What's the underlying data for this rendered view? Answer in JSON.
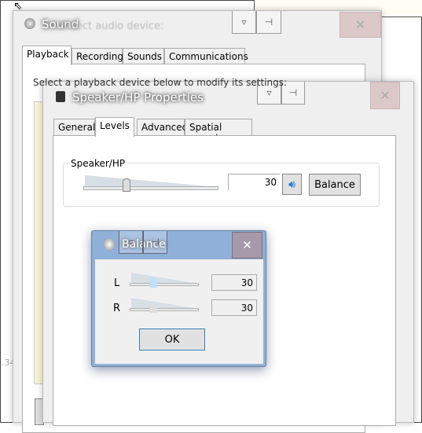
{
  "sound_window": {
    "title": "Sound",
    "subtitle_behind": "Select audio device:",
    "tabs": [
      {
        "label": "Playback",
        "selected": true
      },
      {
        "label": "Recording",
        "selected": false
      },
      {
        "label": "Sounds",
        "selected": false
      },
      {
        "label": "Communications",
        "selected": false
      }
    ],
    "instruction": "Select a playback device below to modify its settings:",
    "close_icon": "close-icon",
    "background_number": ".34"
  },
  "properties_window": {
    "title": "Speaker/HP Properties",
    "tabs": [
      {
        "label": "General",
        "selected": false
      },
      {
        "label": "Levels",
        "selected": true
      },
      {
        "label": "Advanced",
        "selected": false
      },
      {
        "label": "Spatial sound",
        "selected": false
      }
    ],
    "group_label": "Speaker/HP",
    "volume_value": "30",
    "volume_level_percent": 30,
    "mute_icon": "speaker-icon",
    "balance_button": "Balance"
  },
  "balance_dialog": {
    "title": "Balance",
    "left_label": "L",
    "left_value": "30",
    "right_label": "R",
    "right_value": "30",
    "ok_label": "OK",
    "accent_color": "#8fb0d8"
  }
}
